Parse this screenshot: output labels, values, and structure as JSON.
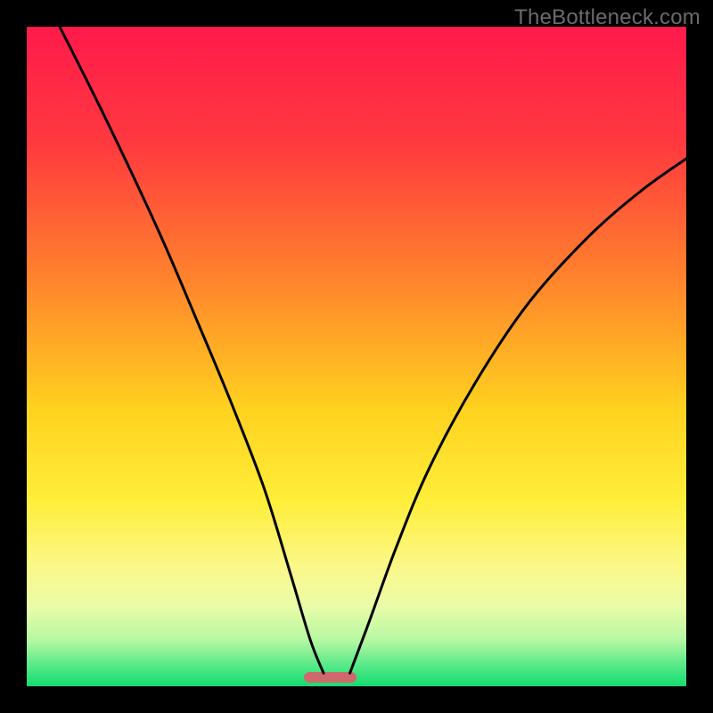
{
  "watermark": "TheBottleneck.com",
  "chart_data": {
    "type": "line",
    "title": "",
    "xlabel": "",
    "ylabel": "",
    "xlim": [
      0,
      100
    ],
    "ylim": [
      0,
      100
    ],
    "gradient_stops": [
      {
        "pct": 0,
        "color": "#ff1a4b"
      },
      {
        "pct": 18,
        "color": "#ff3a3f"
      },
      {
        "pct": 40,
        "color": "#ff8a2b"
      },
      {
        "pct": 58,
        "color": "#ffd21f"
      },
      {
        "pct": 72,
        "color": "#ffee3a"
      },
      {
        "pct": 82,
        "color": "#fbf88a"
      },
      {
        "pct": 88,
        "color": "#e9fca8"
      },
      {
        "pct": 93,
        "color": "#b6f8a2"
      },
      {
        "pct": 97,
        "color": "#53e987"
      },
      {
        "pct": 100,
        "color": "#16db6f"
      }
    ],
    "optimal_marker": {
      "x_start": 42,
      "x_end": 50,
      "y": 1.3,
      "color": "#cf6a6c"
    },
    "series": [
      {
        "name": "left-curve",
        "points": [
          {
            "x": 5,
            "y": 100
          },
          {
            "x": 12,
            "y": 86
          },
          {
            "x": 20,
            "y": 69
          },
          {
            "x": 26,
            "y": 55
          },
          {
            "x": 31,
            "y": 43
          },
          {
            "x": 36,
            "y": 30
          },
          {
            "x": 40,
            "y": 17
          },
          {
            "x": 43,
            "y": 7
          },
          {
            "x": 45,
            "y": 2
          }
        ]
      },
      {
        "name": "right-curve",
        "points": [
          {
            "x": 49,
            "y": 2
          },
          {
            "x": 52,
            "y": 10
          },
          {
            "x": 56,
            "y": 21
          },
          {
            "x": 61,
            "y": 33
          },
          {
            "x": 68,
            "y": 46
          },
          {
            "x": 76,
            "y": 58
          },
          {
            "x": 85,
            "y": 68
          },
          {
            "x": 93,
            "y": 75
          },
          {
            "x": 100,
            "y": 80
          }
        ]
      }
    ]
  }
}
